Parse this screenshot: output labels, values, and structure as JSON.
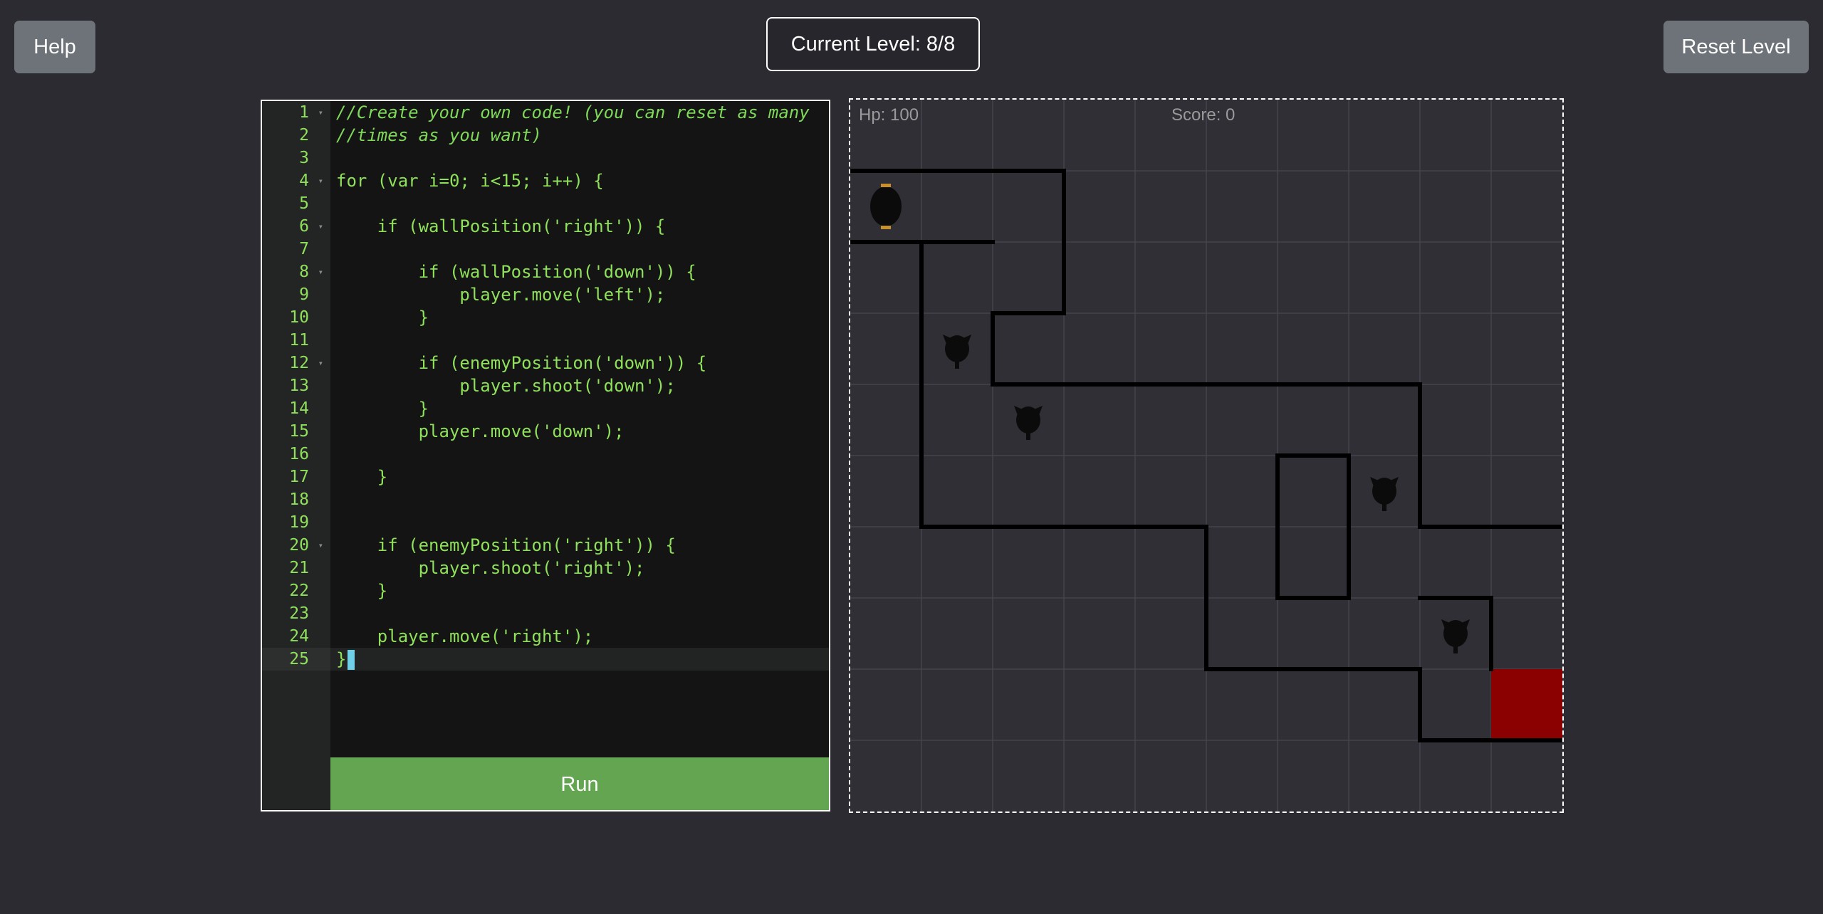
{
  "header": {
    "help_label": "Help",
    "level_text": "Current Level: 8/8",
    "reset_label": "Reset Level"
  },
  "editor": {
    "lines": [
      "//Create your own code! (you can reset as many",
      "//times as you want)",
      "",
      "for (var i=0; i<15; i++) {",
      "",
      "    if (wallPosition('right')) {",
      "",
      "        if (wallPosition('down')) {",
      "            player.move('left');",
      "        }",
      "",
      "        if (enemyPosition('down')) {",
      "            player.shoot('down');",
      "        }",
      "        player.move('down');",
      "",
      "    }",
      "",
      "",
      "    if (enemyPosition('right')) {",
      "        player.shoot('right');",
      "    }",
      "",
      "    player.move('right');",
      "}"
    ],
    "run_label": "Run"
  },
  "game": {
    "hp_text": "Hp: 100",
    "score_text": "Score: 0",
    "colors": {
      "background": "#2f2f35",
      "grid": "#44444c",
      "wall": "#000000",
      "goal": "#8b0000",
      "player_accent": "#c8902a"
    }
  }
}
